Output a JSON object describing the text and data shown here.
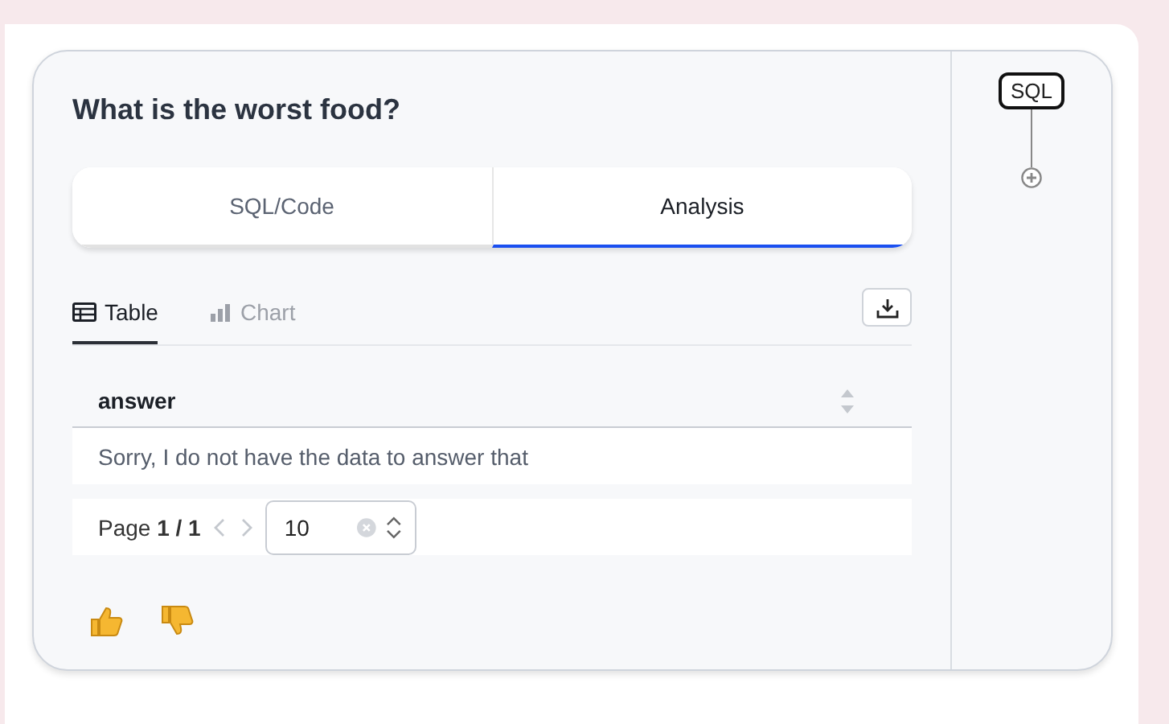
{
  "question": "What is the worst food?",
  "tabs": [
    {
      "label": "SQL/Code",
      "selected": false
    },
    {
      "label": "Analysis",
      "selected": true
    }
  ],
  "view_tabs": [
    {
      "label": "Table",
      "kind": "table",
      "selected": true
    },
    {
      "label": "Chart",
      "kind": "chart",
      "selected": false
    }
  ],
  "table": {
    "columns": [
      "answer"
    ],
    "rows": [
      [
        "Sorry, I do not have the data to answer that"
      ]
    ]
  },
  "pager": {
    "label": "Page **1 / 1**",
    "page_size": "10"
  },
  "flow": {
    "node": "SQL"
  }
}
